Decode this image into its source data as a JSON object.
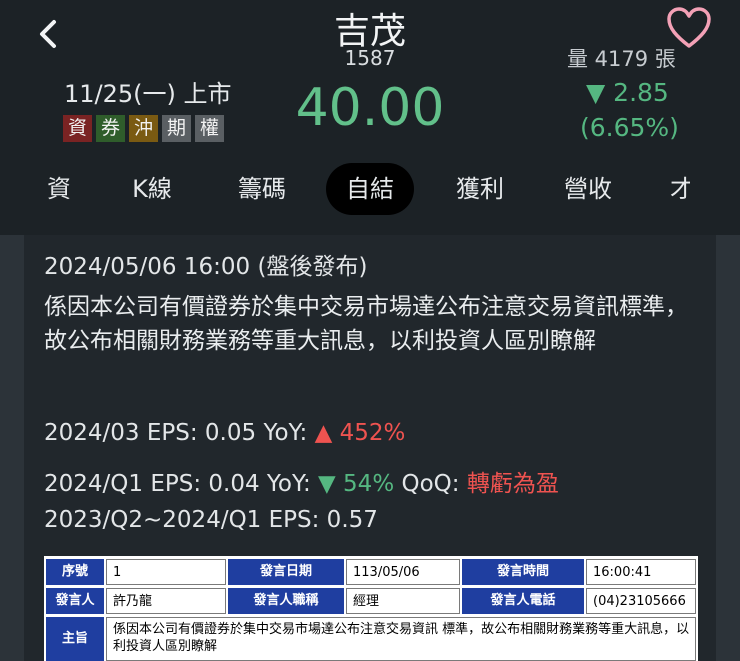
{
  "header": {
    "name": "吉茂",
    "code": "1587",
    "listing": "11/25(一) 上市",
    "tags": [
      {
        "label": "資",
        "color": "#7a2323"
      },
      {
        "label": "券",
        "color": "#2f5d2b"
      },
      {
        "label": "沖",
        "color": "#7a5a12"
      },
      {
        "label": "期",
        "color": "#5a5f63"
      },
      {
        "label": "權",
        "color": "#5a5f63"
      }
    ],
    "price": "40.00",
    "volume": "量 4179 張",
    "change": "▼ 2.85",
    "change_pct": "(6.65%)",
    "colors": {
      "down": "#55b781",
      "up": "#ef5350",
      "heart": "#f3a1b6"
    }
  },
  "tabs": [
    {
      "label": "資"
    },
    {
      "label": "K線"
    },
    {
      "label": "籌碼"
    },
    {
      "label": "自結",
      "active": true
    },
    {
      "label": "獲利"
    },
    {
      "label": "營收"
    },
    {
      "label": "才"
    }
  ],
  "announcement": {
    "datetime": "2024/05/06 16:00 (盤後發布)",
    "text": "係因本公司有價證券於集中交易市場達公布注意交易資訊標準，故公布相關財務業務等重大訊息，以利投資人區別瞭解",
    "monthly": {
      "prefix": "2024/03  EPS: 0.05  YoY: ",
      "yoy": "▲ 452%"
    },
    "quarterly": {
      "prefix": "2024/Q1  EPS: 0.04  YoY: ",
      "yoy": "▼ 54%",
      "qoq_label": "  QoQ: ",
      "qoq": "轉虧為盈"
    },
    "cumulative": "2023/Q2~2024/Q1  EPS: 0.57"
  },
  "table": {
    "row1": [
      "序號",
      "1",
      "發言日期",
      "113/05/06",
      "發言時間",
      "16:00:41"
    ],
    "row2": [
      "發言人",
      "許乃龍",
      "發言人職稱",
      "經理",
      "發言人電話",
      "(04)23105666"
    ],
    "row3": [
      "主旨",
      "係因本公司有價證券於集中交易市場達公布注意交易資訊 標準，故公布相關財務業務等重大訊息，以利投資人區別瞭解"
    ]
  }
}
